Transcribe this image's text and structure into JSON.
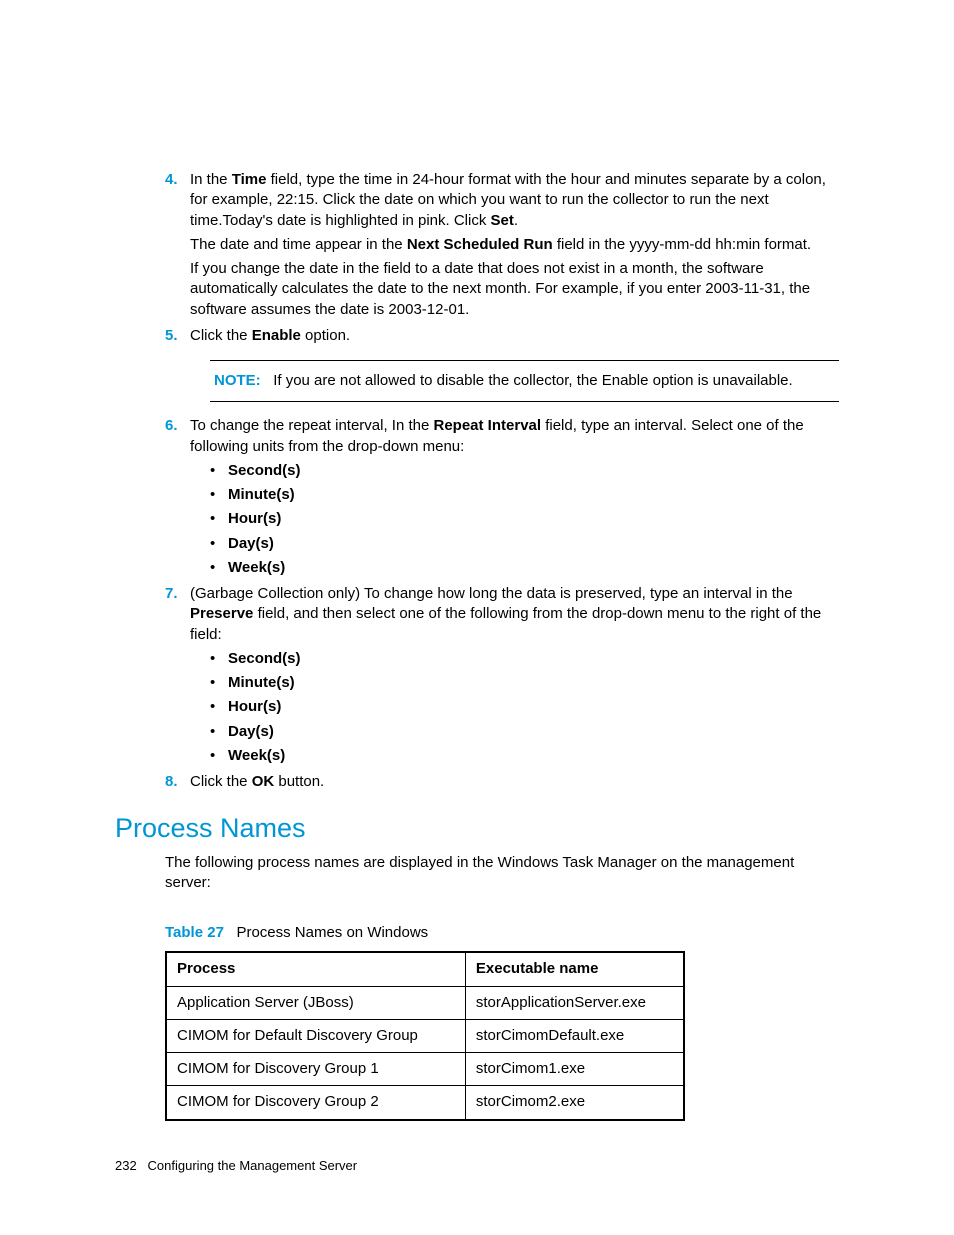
{
  "steps": {
    "s4": {
      "num": "4.",
      "p1_a": "In the ",
      "p1_b": "Time",
      "p1_c": " field, type the time in 24-hour format with the hour and minutes separate by a colon, for example, 22:15. Click the date on which you want to run the collector to run the next time.Today's date is highlighted in pink. Click ",
      "p1_d": "Set",
      "p1_e": ".",
      "p2_a": "The date and time appear in the ",
      "p2_b": "Next Scheduled Run",
      "p2_c": " field in the yyyy-mm-dd hh:min format.",
      "p3": "If you change the date in the field to a date that does not exist in a month, the software automatically calculates the date to the next month. For example, if you enter 2003-11-31, the software assumes the date is 2003-12-01."
    },
    "s5": {
      "num": "5.",
      "a": "Click the ",
      "b": "Enable",
      "c": " option."
    },
    "note": {
      "label": "NOTE:",
      "text": "If you are not allowed to disable the collector, the Enable option is unavailable."
    },
    "s6": {
      "num": "6.",
      "a": "To change the repeat interval, In the ",
      "b": "Repeat Interval",
      "c": " field, type an interval. Select one of the following units from the drop-down menu:",
      "items": [
        "Second(s)",
        "Minute(s)",
        "Hour(s)",
        "Day(s)",
        "Week(s)"
      ]
    },
    "s7": {
      "num": "7.",
      "a": "(Garbage Collection only) To change how long the data is preserved, type an interval in the ",
      "b": "Preserve",
      "c": " field, and then select one of the following from the drop-down menu to the right of the field:",
      "items": [
        "Second(s)",
        "Minute(s)",
        "Hour(s)",
        "Day(s)",
        "Week(s)"
      ]
    },
    "s8": {
      "num": "8.",
      "a": "Click the ",
      "b": "OK",
      "c": " button."
    }
  },
  "section_title": "Process Names",
  "section_intro": "The following process names are displayed in the Windows Task Manager on the management server:",
  "table": {
    "caption_label": "Table 27",
    "caption_text": "Process Names on Windows",
    "headers": [
      "Process",
      "Executable name"
    ],
    "rows": [
      [
        "Application Server (JBoss)",
        "storApplicationServer.exe"
      ],
      [
        "CIMOM for Default Discovery Group",
        "storCimomDefault.exe"
      ],
      [
        "CIMOM for Discovery Group 1",
        "storCimom1.exe"
      ],
      [
        "CIMOM for Discovery Group 2",
        "storCimom2.exe"
      ]
    ]
  },
  "footer": {
    "page": "232",
    "title": "Configuring the Management Server"
  }
}
